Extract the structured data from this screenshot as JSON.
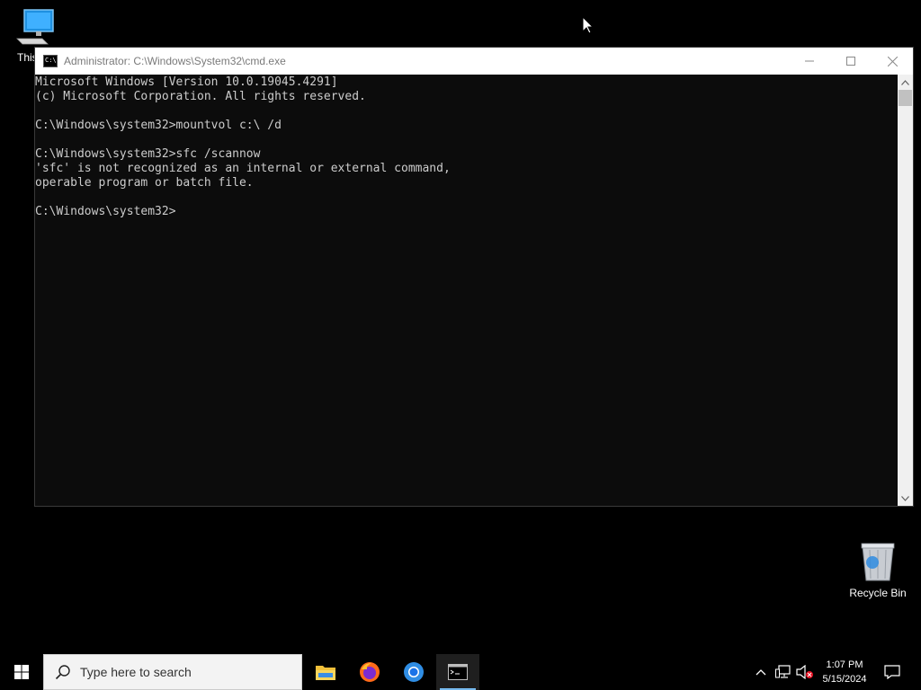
{
  "desktop": {
    "icons": [
      {
        "label": "This PC"
      },
      {
        "label": "Recycle Bin"
      }
    ]
  },
  "window": {
    "title": "Administrator: C:\\Windows\\System32\\cmd.exe",
    "console_lines": [
      "Microsoft Windows [Version 10.0.19045.4291]",
      "(c) Microsoft Corporation. All rights reserved.",
      "",
      "C:\\Windows\\system32>mountvol c:\\ /d",
      "",
      "C:\\Windows\\system32>sfc /scannow",
      "'sfc' is not recognized as an internal or external command,",
      "operable program or batch file.",
      "",
      "C:\\Windows\\system32>"
    ]
  },
  "taskbar": {
    "search_placeholder": "Type here to search",
    "apps": [
      "File Explorer",
      "Firefox",
      "Chrome",
      "Command Prompt"
    ],
    "clock": {
      "time": "1:07 PM",
      "date": "5/15/2024"
    }
  },
  "colors": {
    "console_bg": "#0c0c0c",
    "console_text": "#cccccc",
    "taskbar_bg": "#000000",
    "active_indicator": "#76b9ed"
  }
}
